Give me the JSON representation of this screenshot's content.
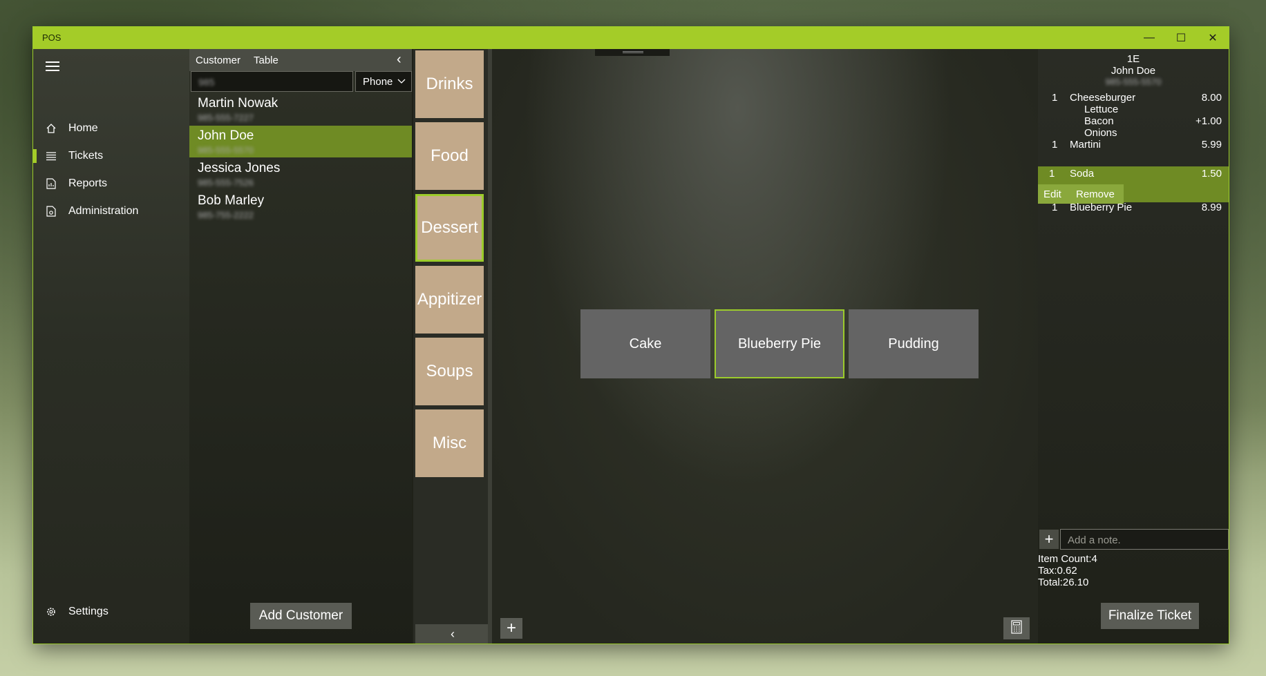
{
  "window": {
    "title": "POS",
    "minimize": "—",
    "maximize": "☐",
    "close": "✕"
  },
  "nav": {
    "items": [
      {
        "label": "Home",
        "icon": "home-icon"
      },
      {
        "label": "Tickets",
        "icon": "list-icon"
      },
      {
        "label": "Reports",
        "icon": "report-icon"
      },
      {
        "label": "Administration",
        "icon": "admin-icon"
      }
    ],
    "settings_label": "Settings",
    "accent": "#a4cc28"
  },
  "customers": {
    "tabs": [
      "Customer",
      "Table"
    ],
    "back": "‹",
    "search_value": "985",
    "filter_selected": "Phone",
    "list": [
      {
        "name": "Martin Nowak",
        "phone": "985-555-7227"
      },
      {
        "name": "John Doe",
        "phone": "985-555-5570"
      },
      {
        "name": "Jessica Jones",
        "phone": "985-555-7526"
      },
      {
        "name": "Bob Marley",
        "phone": "985-755-2222"
      }
    ],
    "add_label": "Add Customer"
  },
  "categories": {
    "items": [
      "Drinks",
      "Food",
      "Dessert",
      "Appitizer",
      "Soups",
      "Misc"
    ],
    "selected": "Dessert",
    "collapse": "‹"
  },
  "products": {
    "items": [
      "Cake",
      "Blueberry Pie",
      "Pudding"
    ],
    "selected": "Blueberry Pie",
    "add": "+"
  },
  "ticket": {
    "table": "1E",
    "customer": "John Doe",
    "phone": "985-555-5570",
    "lines": [
      {
        "qty": "1",
        "desc": "Cheeseburger",
        "price": "8.00"
      },
      {
        "qty": "",
        "desc": "Lettuce",
        "price": ""
      },
      {
        "qty": "",
        "desc": "Bacon",
        "price": "+1.00"
      },
      {
        "qty": "",
        "desc": "Onions",
        "price": ""
      },
      {
        "qty": "1",
        "desc": "Martini",
        "price": "5.99"
      },
      {
        "qty": "1",
        "desc": "Soda",
        "price": "1.50"
      },
      {
        "qty": "1",
        "desc": "Blueberry Pie",
        "price": "8.99"
      }
    ],
    "edit_label": "Edit",
    "remove_label": "Remove",
    "note_add": "+",
    "note_placeholder": "Add a note.",
    "item_count": "Item Count:4",
    "tax": "Tax:0.62",
    "total": "Total:26.10",
    "finalize_label": "Finalize Ticket"
  }
}
